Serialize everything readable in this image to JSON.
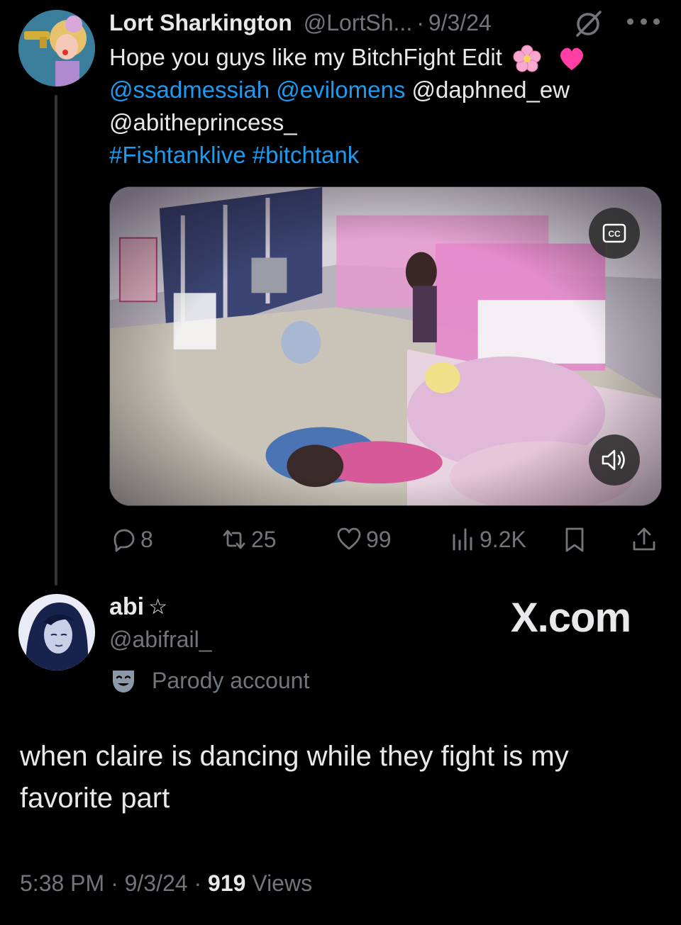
{
  "tweet": {
    "author_name": "Lort Sharkington",
    "author_handle": "@LortSh...",
    "separator": "·",
    "date": "9/3/24",
    "text_main": "Hope you guys like my BitchFight Edit",
    "emojis": [
      "cherry-blossom-icon",
      "pink-heart-icon"
    ],
    "mentions": [
      "@ssadmessiah",
      "@evilomens"
    ],
    "mentions_plain": [
      "@daphned_ew",
      "@abitheprincess_"
    ],
    "hashtags": [
      "#Fishtanklive",
      "#bitchtank"
    ],
    "media_alt_icons": [
      "closed-captions-icon",
      "volume-icon"
    ],
    "cc_label": "CC",
    "actions": {
      "replies": "8",
      "reposts": "25",
      "likes": "99",
      "views": "9.2K"
    }
  },
  "reply": {
    "author_name": "abi",
    "author_star": "☆",
    "author_handle": "@abifrail_",
    "badge_label": "Parody account",
    "text": "when claire is dancing while they fight is my favorite part",
    "time": "5:38 PM",
    "date": "9/3/24",
    "views_count": "919",
    "views_label": "Views",
    "separator": "·"
  },
  "watermark": "X.com",
  "colors": {
    "background": "#000000",
    "text_primary": "#e7e9ea",
    "text_secondary": "#71767b",
    "link": "#1d9bf0"
  }
}
